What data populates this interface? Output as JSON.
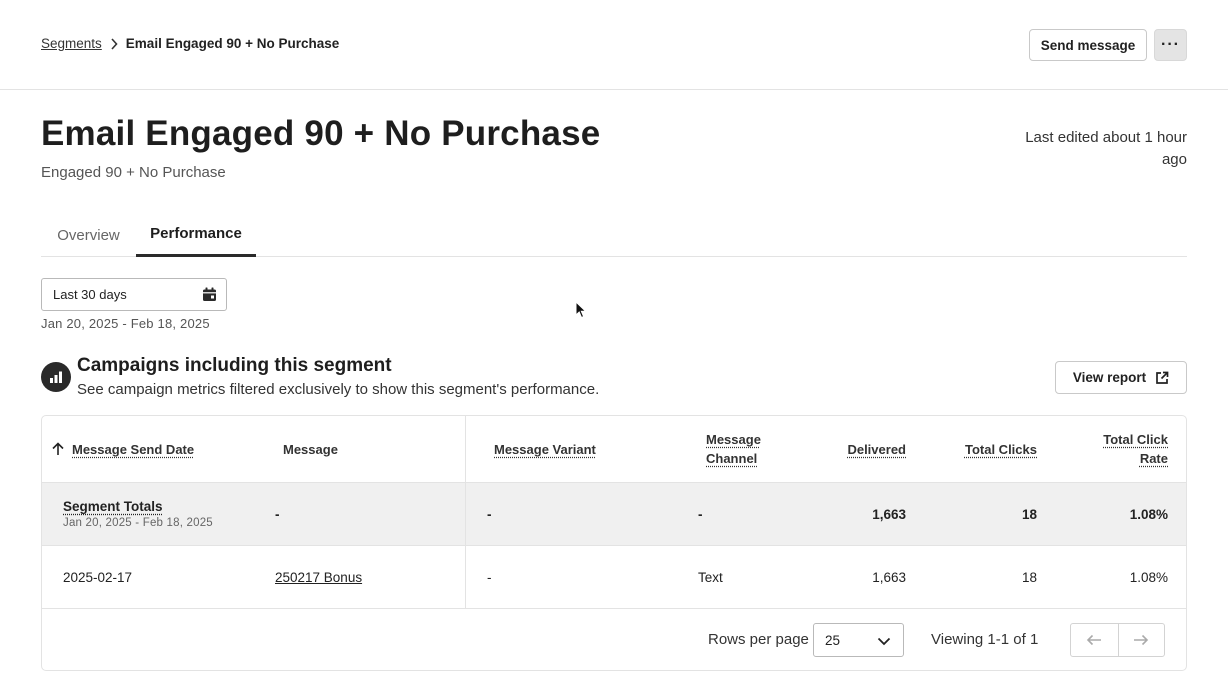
{
  "breadcrumb": {
    "parent": "Segments",
    "current": "Email Engaged 90 + No Purchase"
  },
  "actions": {
    "send_message": "Send message",
    "more": "···"
  },
  "header": {
    "title": "Email Engaged 90 + No Purchase",
    "subtitle": "Engaged 90 + No Purchase",
    "last_edited": "Last edited about 1 hour ago"
  },
  "tabs": [
    {
      "label": "Overview",
      "active": false
    },
    {
      "label": "Performance",
      "active": true
    }
  ],
  "date_filter": {
    "selected": "Last 30 days",
    "range": "Jan 20, 2025 - Feb 18, 2025"
  },
  "campaigns": {
    "title": "Campaigns including this segment",
    "description": "See campaign metrics filtered exclusively to show this segment's performance.",
    "view_report": "View report"
  },
  "table": {
    "columns": {
      "send_date": "Message Send Date",
      "message": "Message",
      "variant": "Message Variant",
      "channel_line1": "Message",
      "channel_line2": "Channel",
      "delivered": "Delivered",
      "clicks": "Total Clicks",
      "click_rate_line1": "Total Click",
      "click_rate_line2": "Rate"
    },
    "totals": {
      "label": "Segment Totals",
      "range": "Jan 20, 2025 - Feb 18, 2025",
      "message": "-",
      "variant": "-",
      "channel": "-",
      "delivered": "1,663",
      "clicks": "18",
      "click_rate": "1.08%"
    },
    "rows": [
      {
        "send_date": "2025-02-17",
        "message": "250217 Bonus",
        "variant": "-",
        "channel": "Text",
        "delivered": "1,663",
        "clicks": "18",
        "click_rate": "1.08%"
      }
    ]
  },
  "pagination": {
    "rows_per_page_label": "Rows per page",
    "rows_per_page": "25",
    "viewing": "Viewing 1-1 of 1"
  },
  "colors": {
    "text_primary": "#1e1e1e",
    "border": "#e3e3e3",
    "totals_bg": "#f0f0f0",
    "dark_icon": "#2a2a2a"
  }
}
